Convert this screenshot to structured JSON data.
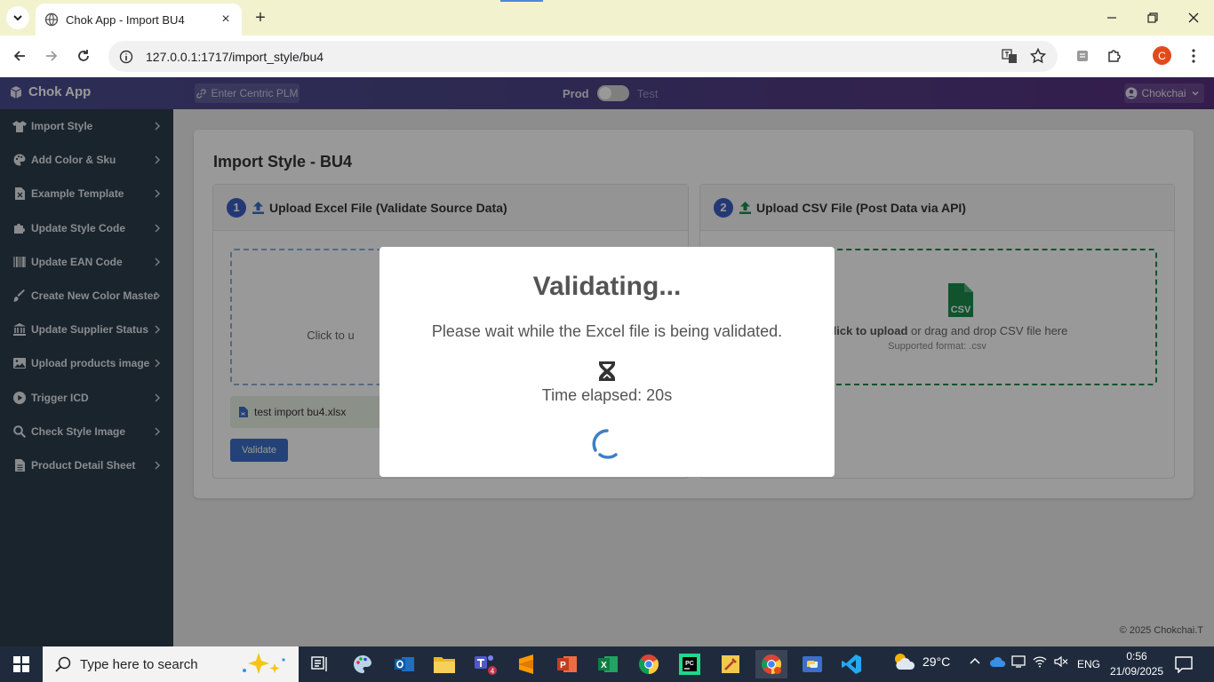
{
  "browser": {
    "tab_title": "Chok App - Import BU4",
    "url": "127.0.0.1:1717/import_style/bu4",
    "profile_initial": "C"
  },
  "app": {
    "brand": "Chok App",
    "centric_button": "Enter Centric PLM",
    "env_prod": "Prod",
    "env_test": "Test",
    "user": "Chokchai"
  },
  "sidebar": {
    "items": [
      {
        "label": "Import Style",
        "icon": "shirt-icon"
      },
      {
        "label": "Add Color & Sku",
        "icon": "palette-icon"
      },
      {
        "label": "Example Template",
        "icon": "excel-file-icon"
      },
      {
        "label": "Update Style Code",
        "icon": "puzzle-icon"
      },
      {
        "label": "Update EAN Code",
        "icon": "barcode-icon"
      },
      {
        "label": "Create New Color Master",
        "icon": "paint-brush-icon"
      },
      {
        "label": "Update Supplier Status",
        "icon": "bank-icon"
      },
      {
        "label": "Upload products image",
        "icon": "image-icon"
      },
      {
        "label": "Trigger ICD",
        "icon": "play-circle-icon"
      },
      {
        "label": "Check Style Image",
        "icon": "search-icon"
      },
      {
        "label": "Product Detail Sheet",
        "icon": "file-icon"
      }
    ]
  },
  "page": {
    "title": "Import Style - BU4",
    "panel1": {
      "step": "1",
      "title": "Upload Excel File (Validate Source Data)",
      "drop_text": "Click to u",
      "file_name": "test import bu4.xlsx",
      "validate_label": "Validate"
    },
    "panel2": {
      "step": "2",
      "title": "Upload CSV File (Post Data via API)",
      "drop_bold": "lick to upload",
      "drop_text": " or drag and drop CSV file here",
      "drop_sub": "Supported format: .csv"
    },
    "copyright": "© 2025 Chokchai.T"
  },
  "modal": {
    "title": "Validating...",
    "message": "Please wait while the Excel file is being validated.",
    "elapsed": "Time elapsed: 20s"
  },
  "taskbar": {
    "search_placeholder": "Type here to search",
    "teams_badge": "4",
    "weather": "29°C",
    "lang": "ENG",
    "time": "0:56",
    "date": "21/09/2025"
  },
  "colors": {
    "accent": "#3b5fc4",
    "nav_gradient_start": "#4a4c8f",
    "nav_gradient_end": "#58307f",
    "sidebar": "#2c3c4c",
    "csv_green": "#1c8a4c"
  }
}
